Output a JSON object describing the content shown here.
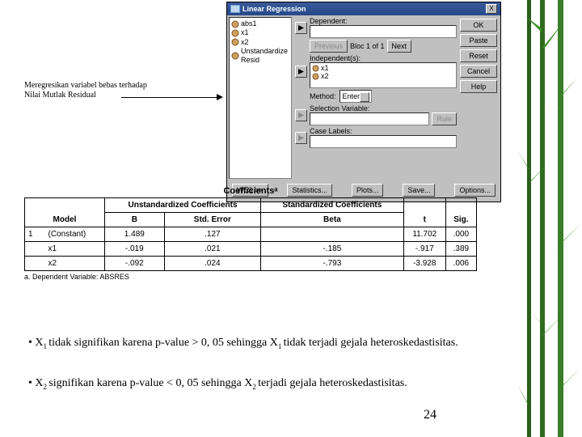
{
  "annotation": {
    "line1": "Meregresikan variabel bebas terhadap",
    "line2": "Nilai Mutlak Residual"
  },
  "dialog": {
    "title": "Linear Regression",
    "close_x": "X",
    "vars": [
      "abs1",
      "x1",
      "x2",
      "Unstandardize Resid"
    ],
    "dependent_label": "Dependent:",
    "dependent_value": "",
    "previous": "Previous",
    "block_label": "Bloc 1 of 1",
    "next": "Next",
    "independent_label": "Independent(s):",
    "indep_items": [
      "x1",
      "x2"
    ],
    "method_label": "Method:",
    "method_value": "Enter",
    "selection_label": "Selection Variable:",
    "selection_value": "",
    "rule_btn": "Rule",
    "case_label": "Case Labels:",
    "case_value": "",
    "right_ok": "OK",
    "right_paste": "Paste",
    "right_reset": "Reset",
    "right_cancel": "Cancel",
    "right_help": "Help",
    "bottom_wls": "WLS >>",
    "bottom_stats": "Statistics...",
    "bottom_plots": "Plots...",
    "bottom_save": "Save...",
    "bottom_options": "Options..."
  },
  "coef": {
    "title": "Coefficientsᵃ",
    "h_model": "Model",
    "h_unstd": "Unstandardized Coefficients",
    "h_std": "Standardized Coefficients",
    "h_b": "B",
    "h_se": "Std. Error",
    "h_beta": "Beta",
    "h_t": "t",
    "h_sig": "Sig.",
    "rows": [
      {
        "m": "1",
        "name": "(Constant)",
        "b": "1.489",
        "se": ".127",
        "beta": "",
        "t": "11.702",
        "sig": ".000"
      },
      {
        "m": "",
        "name": "x1",
        "b": "-.019",
        "se": ".021",
        "beta": "-.185",
        "t": "-.917",
        "sig": ".389"
      },
      {
        "m": "",
        "name": "x2",
        "b": "-.092",
        "se": ".024",
        "beta": "-.793",
        "t": "-3.928",
        "sig": ".006"
      }
    ],
    "footnote": "a. Dependent Variable: ABSRES"
  },
  "bullets": {
    "b1": "tidak signifikan karena p-value > 0, 05 sehingga X",
    "b1b": "tidak   terjadi gejala heteroskedastisitas.",
    "b2": "signifikan karena p-value < 0, 05 sehingga X",
    "b2b": "terjadi gejala heteroskedastisitas."
  },
  "pagenum": "24"
}
